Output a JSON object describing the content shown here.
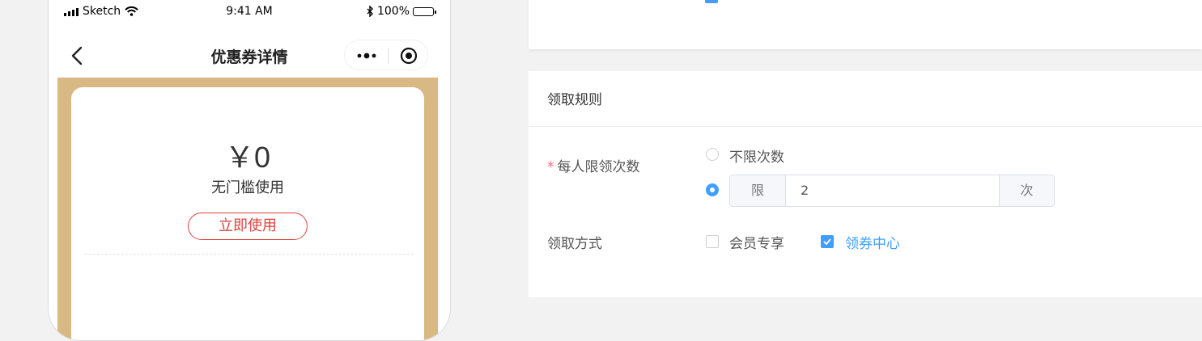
{
  "colors": {
    "accent": "#409eff",
    "danger": "#e04040",
    "coupon_bg": "#d8b983",
    "required": "#f56c6c"
  },
  "phone": {
    "status_bar": {
      "carrier": "Sketch",
      "time": "9:41 AM",
      "battery": "100%"
    },
    "nav": {
      "title": "优惠券详情",
      "back_icon": "chevron-left-icon",
      "more_icon": "more-dots-icon",
      "close_icon": "target-icon"
    },
    "coupon": {
      "amount": "￥0",
      "condition": "无门槛使用",
      "use_button": "立即使用"
    }
  },
  "form": {
    "section_title": "领取规则",
    "limit": {
      "label": "每人限领次数",
      "required_mark": "*",
      "option_unlimited": "不限次数",
      "option_limit_prefix": "限",
      "option_limit_value": "2",
      "option_limit_suffix": "次",
      "selected": "limit"
    },
    "method": {
      "label": "领取方式",
      "options": [
        {
          "label": "会员专享",
          "checked": false
        },
        {
          "label": "领券中心",
          "checked": true
        }
      ]
    }
  }
}
